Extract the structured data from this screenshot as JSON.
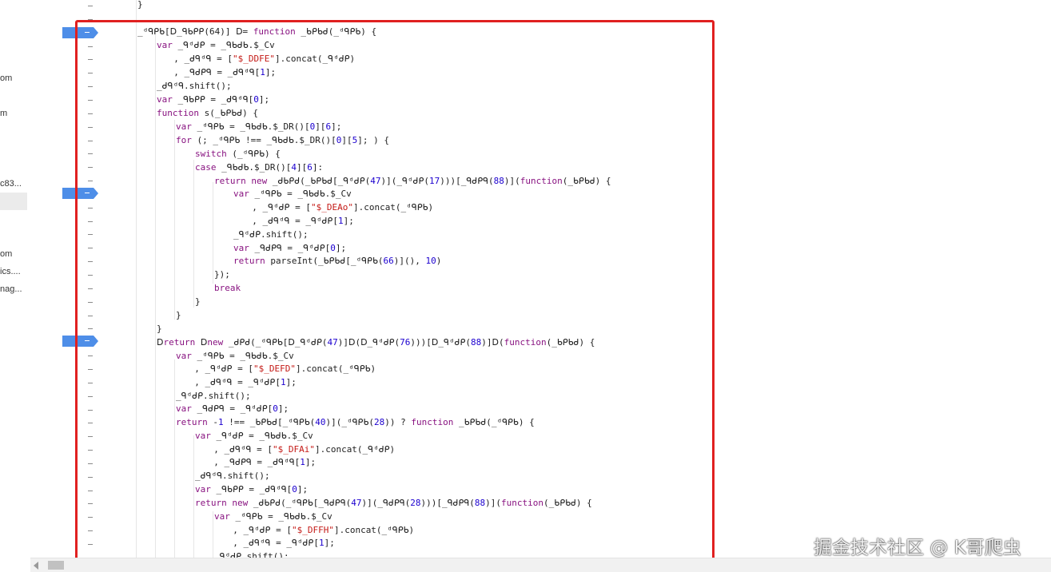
{
  "file_list": [
    {
      "text": "om"
    },
    {
      "text": "m"
    },
    {
      "text": "c83..."
    },
    {
      "text": "om"
    },
    {
      "text": "ics...."
    },
    {
      "text": "nag..."
    }
  ],
  "code_lines": [
    {
      "segs": [
        [
          "}",
          "p"
        ]
      ]
    },
    {
      "segs": [
        [
          "_ᵈᑫᑭᑲ[ᗞ_ᑫᑲᑭᑭ(64)] ᗞ= ",
          "p"
        ],
        [
          "function",
          "k"
        ],
        [
          " _ᑲᑭᑲᑯ(_ᵈᑫᑭᑲ) {",
          "p"
        ]
      ]
    },
    {
      "segs": [
        [
          "var",
          "k"
        ],
        [
          " _ᑫᵈᑯᑭ = _ᑫᑲᑯᑲ.$_Cv",
          "p"
        ]
      ]
    },
    {
      "segs": [
        [
          "  , _ᑯᑫᵈᑫ = [",
          "p"
        ],
        [
          "\"$_DDFE\"",
          "s"
        ],
        [
          "].concat(_ᑫᵈᑯᑭ)",
          "p"
        ]
      ]
    },
    {
      "segs": [
        [
          "  , _ᑫᑯᑭᑫ = _ᑯᑫᵈᑫ[",
          "p"
        ],
        [
          "1",
          "n"
        ],
        [
          "];",
          "p"
        ]
      ]
    },
    {
      "segs": [
        [
          "_ᑯᑫᵈᑫ.shift();",
          "p"
        ]
      ]
    },
    {
      "segs": [
        [
          "var",
          "k"
        ],
        [
          " _ᑫᑲᑭᑭ = _ᑯᑫᵈᑫ[",
          "p"
        ],
        [
          "0",
          "n"
        ],
        [
          "];",
          "p"
        ]
      ]
    },
    {
      "segs": [
        [
          "function",
          "k"
        ],
        [
          " s(_ᑲᑭᑲᑯ) {",
          "p"
        ]
      ]
    },
    {
      "segs": [
        [
          "var",
          "k"
        ],
        [
          " _ᵈᑫᑭᑲ = _ᑫᑲᑯᑲ.$_DR()[",
          "p"
        ],
        [
          "0",
          "n"
        ],
        [
          "][",
          "p"
        ],
        [
          "6",
          "n"
        ],
        [
          "];",
          "p"
        ]
      ]
    },
    {
      "segs": [
        [
          "for",
          "k"
        ],
        [
          " (; _ᵈᑫᑭᑲ !== _ᑫᑲᑯᑲ.$_DR()[",
          "p"
        ],
        [
          "0",
          "n"
        ],
        [
          "][",
          "p"
        ],
        [
          "5",
          "n"
        ],
        [
          "]; ) {",
          "p"
        ]
      ]
    },
    {
      "segs": [
        [
          "switch",
          "k"
        ],
        [
          " (_ᵈᑫᑭᑲ) {",
          "p"
        ]
      ]
    },
    {
      "segs": [
        [
          "case",
          "k"
        ],
        [
          " _ᑫᑲᑯᑲ.$_DR()[",
          "p"
        ],
        [
          "4",
          "n"
        ],
        [
          "][",
          "p"
        ],
        [
          "6",
          "n"
        ],
        [
          "]:",
          "p"
        ]
      ]
    },
    {
      "segs": [
        [
          "return new",
          "k"
        ],
        [
          " _ᑯᑲᑭᑯ(_ᑲᑭᑲᑯ[_ᑫᵈᑯᑭ(",
          "p"
        ],
        [
          "47",
          "n"
        ],
        [
          ")](_ᑫᵈᑯᑭ(",
          "p"
        ],
        [
          "17",
          "n"
        ],
        [
          ")))[_ᑫᑯᑭᑫ(",
          "p"
        ],
        [
          "88",
          "n"
        ],
        [
          ")](",
          "p"
        ],
        [
          "function",
          "k"
        ],
        [
          "(_ᑲᑭᑲᑯ) {",
          "p"
        ]
      ]
    },
    {
      "segs": [
        [
          "var",
          "k"
        ],
        [
          " _ᵈᑫᑭᑲ = _ᑫᑲᑯᑲ.$_Cv",
          "p"
        ]
      ]
    },
    {
      "segs": [
        [
          "  , _ᑫᵈᑯᑭ = [",
          "p"
        ],
        [
          "\"$_DEAo\"",
          "s"
        ],
        [
          "].concat(_ᵈᑫᑭᑲ)",
          "p"
        ]
      ]
    },
    {
      "segs": [
        [
          "  , _ᑯᑫᵈᑫ = _ᑫᵈᑯᑭ[",
          "p"
        ],
        [
          "1",
          "n"
        ],
        [
          "];",
          "p"
        ]
      ]
    },
    {
      "segs": [
        [
          "_ᑫᵈᑯᑭ.shift();",
          "p"
        ]
      ]
    },
    {
      "segs": [
        [
          "var",
          "k"
        ],
        [
          " _ᑫᑯᑭᑫ = _ᑫᵈᑯᑭ[",
          "p"
        ],
        [
          "0",
          "n"
        ],
        [
          "];",
          "p"
        ]
      ]
    },
    {
      "segs": [
        [
          "return",
          "k"
        ],
        [
          " parseInt(_ᑲᑭᑲᑯ[_ᵈᑫᑭᑲ(",
          "p"
        ],
        [
          "66",
          "n"
        ],
        [
          ")](), ",
          "p"
        ],
        [
          "10",
          "n"
        ],
        [
          ")",
          "p"
        ]
      ]
    },
    {
      "segs": [
        [
          "});",
          "p"
        ]
      ]
    },
    {
      "segs": [
        [
          "break",
          "k"
        ]
      ]
    },
    {
      "segs": [
        [
          "}",
          "p"
        ]
      ]
    },
    {
      "segs": [
        [
          "}",
          "p"
        ]
      ]
    },
    {
      "segs": [
        [
          "}",
          "p"
        ]
      ]
    },
    {
      "segs": [
        [
          "ᗞ",
          "p"
        ],
        [
          "return",
          "k"
        ],
        [
          " ᗞ",
          "p"
        ],
        [
          "new",
          "k"
        ],
        [
          " _ᑯᑭᑯ(_ᵈᑫᑭᑲ[ᗞ_ᑫᵈᑯᑭ(",
          "p"
        ],
        [
          "47",
          "n"
        ],
        [
          ")]ᗞ(ᗞ_ᑫᵈᑯᑭ(",
          "p"
        ],
        [
          "76",
          "n"
        ],
        [
          ")))[ᗞ_ᑫᵈᑯᑭ(",
          "p"
        ],
        [
          "88",
          "n"
        ],
        [
          ")]ᗞ(",
          "p"
        ],
        [
          "function",
          "k"
        ],
        [
          "(_ᑲᑭᑲᑯ) {",
          "p"
        ]
      ]
    },
    {
      "segs": [
        [
          "var",
          "k"
        ],
        [
          " _ᵈᑫᑭᑲ = _ᑫᑲᑯᑲ.$_Cv",
          "p"
        ]
      ]
    },
    {
      "segs": [
        [
          "  , _ᑫᵈᑯᑭ = [",
          "p"
        ],
        [
          "\"$_DEFD\"",
          "s"
        ],
        [
          "].concat(_ᵈᑫᑭᑲ)",
          "p"
        ]
      ]
    },
    {
      "segs": [
        [
          "  , _ᑯᑫᵈᑫ = _ᑫᵈᑯᑭ[",
          "p"
        ],
        [
          "1",
          "n"
        ],
        [
          "];",
          "p"
        ]
      ]
    },
    {
      "segs": [
        [
          "_ᑫᵈᑯᑭ.shift();",
          "p"
        ]
      ]
    },
    {
      "segs": [
        [
          "var",
          "k"
        ],
        [
          " _ᑫᑯᑭᑫ = _ᑫᵈᑯᑭ[",
          "p"
        ],
        [
          "0",
          "n"
        ],
        [
          "];",
          "p"
        ]
      ]
    },
    {
      "segs": [
        [
          "return",
          "k"
        ],
        [
          " -",
          "p"
        ],
        [
          "1",
          "n"
        ],
        [
          " !== _ᑲᑭᑲᑯ[_ᵈᑫᑭᑲ(",
          "p"
        ],
        [
          "40",
          "n"
        ],
        [
          ")](_ᵈᑫᑭᑲ(",
          "p"
        ],
        [
          "28",
          "n"
        ],
        [
          ")) ? ",
          "p"
        ],
        [
          "function",
          "k"
        ],
        [
          " _ᑲᑭᑲᑯ(_ᵈᑫᑭᑲ) {",
          "p"
        ]
      ]
    },
    {
      "segs": [
        [
          "var",
          "k"
        ],
        [
          " _ᑫᵈᑯᑭ = _ᑫᑲᑯᑲ.$_Cv",
          "p"
        ]
      ]
    },
    {
      "segs": [
        [
          "  , _ᑯᑫᵈᑫ = [",
          "p"
        ],
        [
          "\"$_DFAi\"",
          "s"
        ],
        [
          "].concat(_ᑫᵈᑯᑭ)",
          "p"
        ]
      ]
    },
    {
      "segs": [
        [
          "  , _ᑫᑯᑭᑫ = _ᑯᑫᵈᑫ[",
          "p"
        ],
        [
          "1",
          "n"
        ],
        [
          "];",
          "p"
        ]
      ]
    },
    {
      "segs": [
        [
          "_ᑯᑫᵈᑫ.shift();",
          "p"
        ]
      ]
    },
    {
      "segs": [
        [
          "var",
          "k"
        ],
        [
          " _ᑫᑲᑭᑭ = _ᑯᑫᵈᑫ[",
          "p"
        ],
        [
          "0",
          "n"
        ],
        [
          "];",
          "p"
        ]
      ]
    },
    {
      "segs": [
        [
          "return new",
          "k"
        ],
        [
          " _ᑯᑲᑭᑯ(_ᵈᑫᑭᑲ[_ᑫᑯᑭᑫ(",
          "p"
        ],
        [
          "47",
          "n"
        ],
        [
          ")](_ᑫᑯᑭᑫ(",
          "p"
        ],
        [
          "28",
          "n"
        ],
        [
          ")))[_ᑫᑯᑭᑫ(",
          "p"
        ],
        [
          "88",
          "n"
        ],
        [
          ")](",
          "p"
        ],
        [
          "function",
          "k"
        ],
        [
          "(_ᑲᑭᑲᑯ) {",
          "p"
        ]
      ]
    },
    {
      "segs": [
        [
          "var",
          "k"
        ],
        [
          " _ᵈᑫᑭᑲ = _ᑫᑲᑯᑲ.$_Cv",
          "p"
        ]
      ]
    },
    {
      "segs": [
        [
          "  , _ᑫᵈᑯᑭ = [",
          "p"
        ],
        [
          "\"$_DFFH\"",
          "s"
        ],
        [
          "].concat(_ᵈᑫᑭᑲ)",
          "p"
        ]
      ]
    },
    {
      "segs": [
        [
          "  , _ᑯᑫᵈᑫ = _ᑫᵈᑯᑭ[",
          "p"
        ],
        [
          "1",
          "n"
        ],
        [
          "];",
          "p"
        ]
      ]
    },
    {
      "segs": [
        [
          "_ᑫᵈᑯᑭ.shift();",
          "p"
        ]
      ]
    }
  ],
  "watermark": {
    "text": "掘金技术社区 @ K哥爬虫"
  },
  "colors": {
    "breakpoint": "#4e8ee8",
    "highlight_border": "#e02020",
    "keyword": "#881280",
    "string": "#c41a16",
    "number": "#1c00cf"
  }
}
